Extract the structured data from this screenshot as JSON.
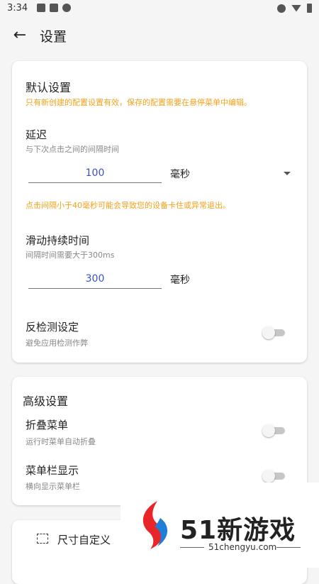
{
  "statusbar": {
    "time": "3:34"
  },
  "appbar": {
    "title": "设置"
  },
  "defaults": {
    "heading": "默认设置",
    "note": "只有新创建的配置设置有效，保存的配置需要在悬停菜单中编辑。",
    "delay": {
      "label": "延迟",
      "desc": "与下次点击之间的间隔时间",
      "value": "100",
      "unit": "毫秒",
      "warning": "点击间隔小于40毫秒可能会导致您的设备卡住或异常退出。"
    },
    "swipe": {
      "label": "滑动持续时间",
      "desc": "间隔时间需要大于300ms",
      "value": "300",
      "unit": "毫秒"
    },
    "anti_detect": {
      "label": "反检测设定",
      "desc": "避免应用检测作弊",
      "enabled": false
    }
  },
  "advanced": {
    "heading": "高级设置",
    "fold_menu": {
      "label": "折叠菜单",
      "desc": "运行时菜单自动折叠",
      "enabled": false
    },
    "menubar": {
      "label": "菜单栏显示",
      "desc": "横向显示菜单栏",
      "enabled": false
    }
  },
  "size": {
    "label": "尺寸自定义"
  },
  "watermark": {
    "brand": "51新游戏",
    "url": "51chengyu.com"
  },
  "colors": {
    "accent_text": "#3a52c4",
    "warning": "#f3a21b",
    "logo_red": "#e8262a",
    "logo_blue": "#1e7fd9"
  },
  "icons": [
    "back-arrow-icon",
    "dropdown-caret-icon",
    "crop-icon",
    "brand-logo-icon"
  ]
}
